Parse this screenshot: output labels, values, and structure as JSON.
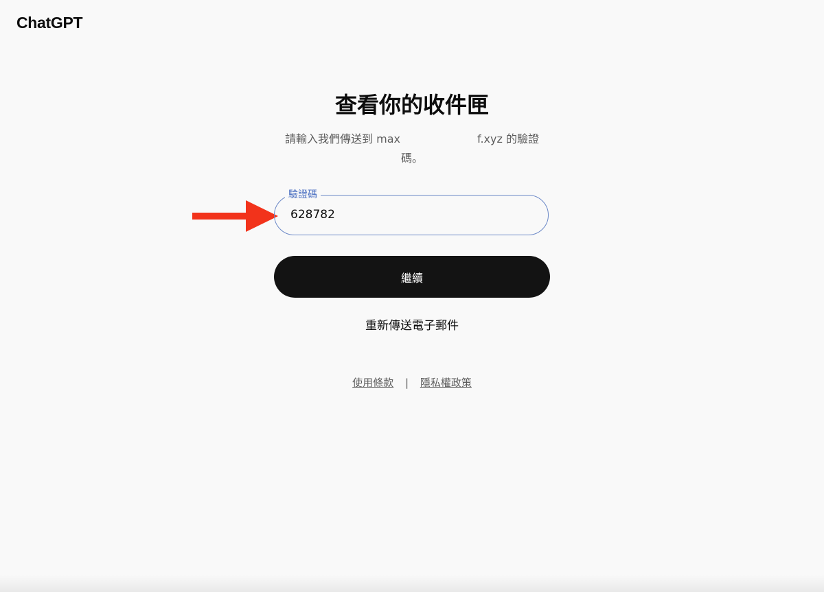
{
  "brand": {
    "logo_text": "ChatGPT"
  },
  "main": {
    "title": "查看你的收件匣",
    "subtitle_prefix": "請輸入我們傳送到 max",
    "subtitle_redacted_mark": "_",
    "subtitle_suffix": "f.xyz 的驗證碼。",
    "code_field": {
      "label": "驗證碼",
      "value": "628782",
      "state": "focused"
    },
    "continue_label": "繼續",
    "resend_label": "重新傳送電子郵件"
  },
  "footer": {
    "terms_label": "使用條款",
    "separator": "|",
    "privacy_label": "隱私權政策"
  },
  "annotation": {
    "arrow_color": "#f2331b"
  },
  "colors": {
    "background": "#f9f9f9",
    "focus_border": "#6b88c7",
    "focus_label": "#4a6fc1",
    "button_bg": "#131313"
  }
}
